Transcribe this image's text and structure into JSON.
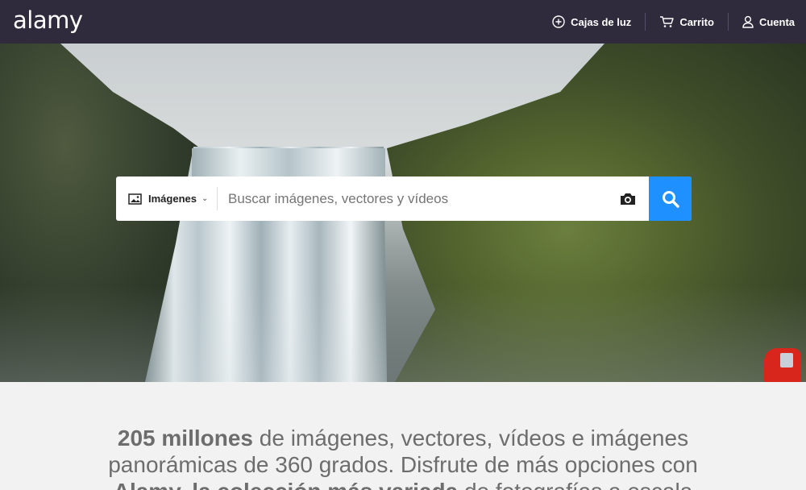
{
  "header": {
    "logo": "alamy",
    "nav": [
      {
        "label": "Cajas de luz",
        "icon": "plus-circle-icon"
      },
      {
        "label": "Carrito",
        "icon": "cart-icon"
      },
      {
        "label": "Cuenta",
        "icon": "user-icon"
      }
    ]
  },
  "search": {
    "type_label": "Imágenes",
    "type_icon": "image-icon",
    "placeholder": "Buscar imágenes, vectores y vídeos",
    "camera_icon": "camera-icon",
    "submit_icon": "search-icon",
    "accent_color": "#1e90ff"
  },
  "intro": {
    "bold_count": "205 millones",
    "line1_rest": " de imágenes, vectores, vídeos e imágenes",
    "line2": "panorámicas de 360 grados. Disfrute de más opciones con",
    "bold_brand": "Alamy, la colección más variada",
    "line3_rest": " de fotografías a escala"
  },
  "colors": {
    "header_bg": "#2f2b3d",
    "page_bg": "#f2f2f2",
    "intro_text": "#6d6d6d"
  }
}
